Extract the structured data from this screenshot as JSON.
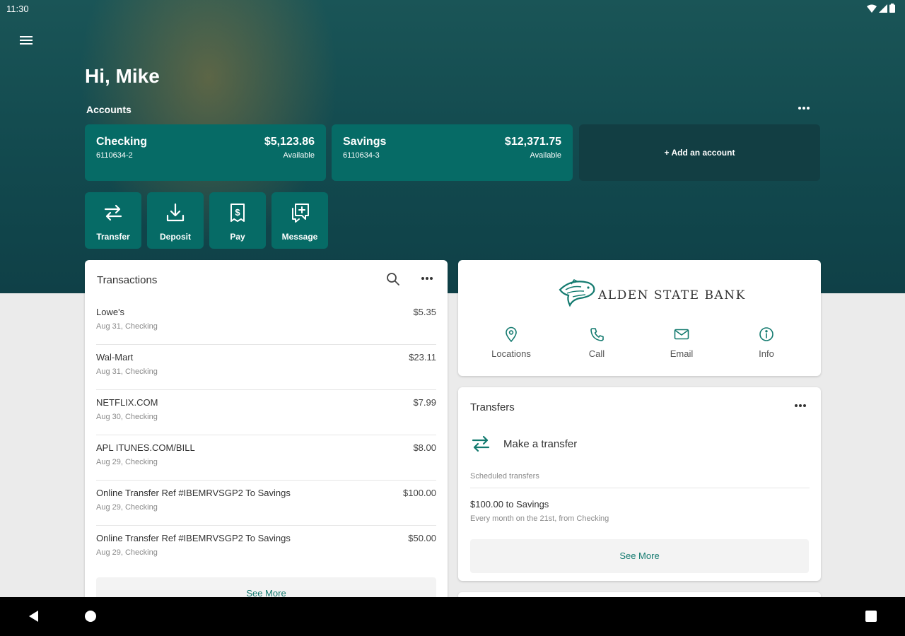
{
  "status_bar": {
    "time": "11:30"
  },
  "header": {
    "greeting": "Hi, Mike",
    "accounts_label": "Accounts"
  },
  "accounts": [
    {
      "name": "Checking",
      "number": "6110634-2",
      "balance": "$5,123.86",
      "balance_label": "Available"
    },
    {
      "name": "Savings",
      "number": "6110634-3",
      "balance": "$12,371.75",
      "balance_label": "Available"
    }
  ],
  "add_account_label": "+ Add an account",
  "quick_actions": [
    {
      "label": "Transfer",
      "icon": "transfer-icon"
    },
    {
      "label": "Deposit",
      "icon": "deposit-icon"
    },
    {
      "label": "Pay",
      "icon": "pay-icon"
    },
    {
      "label": "Message",
      "icon": "message-icon"
    }
  ],
  "transactions": {
    "title": "Transactions",
    "items": [
      {
        "name": "Lowe's",
        "meta": "Aug 31, Checking",
        "amount": "$5.35"
      },
      {
        "name": "Wal-Mart",
        "meta": "Aug 31, Checking",
        "amount": "$23.11"
      },
      {
        "name": "NETFLIX.COM",
        "meta": "Aug 30, Checking",
        "amount": "$7.99"
      },
      {
        "name": "APL ITUNES.COM/BILL",
        "meta": "Aug 29, Checking",
        "amount": "$8.00"
      },
      {
        "name": "Online Transfer Ref #IBEMRVSGP2 To Savings",
        "meta": "Aug 29, Checking",
        "amount": "$100.00"
      },
      {
        "name": "Online Transfer Ref #IBEMRVSGP2 To Savings",
        "meta": "Aug 29, Checking",
        "amount": "$50.00"
      }
    ],
    "see_more": "See More"
  },
  "bank": {
    "name": "ALDEN STATE BANK",
    "actions": [
      {
        "label": "Locations",
        "icon": "location-pin-icon"
      },
      {
        "label": "Call",
        "icon": "phone-icon"
      },
      {
        "label": "Email",
        "icon": "email-icon"
      },
      {
        "label": "Info",
        "icon": "info-icon"
      }
    ]
  },
  "transfers": {
    "title": "Transfers",
    "make_transfer": "Make a transfer",
    "scheduled_label": "Scheduled transfers",
    "scheduled": [
      {
        "title": "$100.00 to Savings",
        "subtitle": "Every month on the 21st, from Checking"
      }
    ],
    "see_more": "See More"
  },
  "colors": {
    "accent": "#066b66",
    "hero": "#12494e",
    "link": "#137a6f"
  }
}
